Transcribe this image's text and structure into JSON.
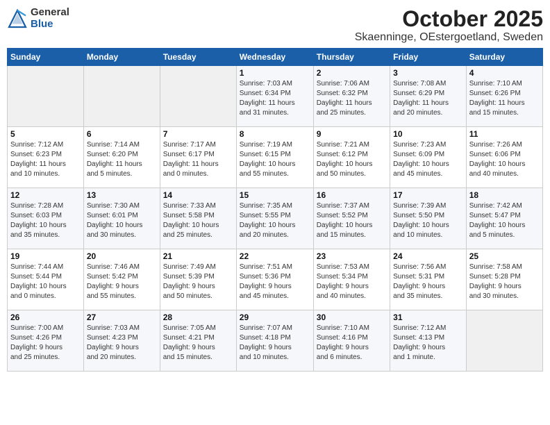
{
  "header": {
    "logo_general": "General",
    "logo_blue": "Blue",
    "month_title": "October 2025",
    "location": "Skaenninge, OEstergoetland, Sweden"
  },
  "days_of_week": [
    "Sunday",
    "Monday",
    "Tuesday",
    "Wednesday",
    "Thursday",
    "Friday",
    "Saturday"
  ],
  "weeks": [
    [
      {
        "day": "",
        "info": ""
      },
      {
        "day": "",
        "info": ""
      },
      {
        "day": "",
        "info": ""
      },
      {
        "day": "1",
        "info": "Sunrise: 7:03 AM\nSunset: 6:34 PM\nDaylight: 11 hours\nand 31 minutes."
      },
      {
        "day": "2",
        "info": "Sunrise: 7:06 AM\nSunset: 6:32 PM\nDaylight: 11 hours\nand 25 minutes."
      },
      {
        "day": "3",
        "info": "Sunrise: 7:08 AM\nSunset: 6:29 PM\nDaylight: 11 hours\nand 20 minutes."
      },
      {
        "day": "4",
        "info": "Sunrise: 7:10 AM\nSunset: 6:26 PM\nDaylight: 11 hours\nand 15 minutes."
      }
    ],
    [
      {
        "day": "5",
        "info": "Sunrise: 7:12 AM\nSunset: 6:23 PM\nDaylight: 11 hours\nand 10 minutes."
      },
      {
        "day": "6",
        "info": "Sunrise: 7:14 AM\nSunset: 6:20 PM\nDaylight: 11 hours\nand 5 minutes."
      },
      {
        "day": "7",
        "info": "Sunrise: 7:17 AM\nSunset: 6:17 PM\nDaylight: 11 hours\nand 0 minutes."
      },
      {
        "day": "8",
        "info": "Sunrise: 7:19 AM\nSunset: 6:15 PM\nDaylight: 10 hours\nand 55 minutes."
      },
      {
        "day": "9",
        "info": "Sunrise: 7:21 AM\nSunset: 6:12 PM\nDaylight: 10 hours\nand 50 minutes."
      },
      {
        "day": "10",
        "info": "Sunrise: 7:23 AM\nSunset: 6:09 PM\nDaylight: 10 hours\nand 45 minutes."
      },
      {
        "day": "11",
        "info": "Sunrise: 7:26 AM\nSunset: 6:06 PM\nDaylight: 10 hours\nand 40 minutes."
      }
    ],
    [
      {
        "day": "12",
        "info": "Sunrise: 7:28 AM\nSunset: 6:03 PM\nDaylight: 10 hours\nand 35 minutes."
      },
      {
        "day": "13",
        "info": "Sunrise: 7:30 AM\nSunset: 6:01 PM\nDaylight: 10 hours\nand 30 minutes."
      },
      {
        "day": "14",
        "info": "Sunrise: 7:33 AM\nSunset: 5:58 PM\nDaylight: 10 hours\nand 25 minutes."
      },
      {
        "day": "15",
        "info": "Sunrise: 7:35 AM\nSunset: 5:55 PM\nDaylight: 10 hours\nand 20 minutes."
      },
      {
        "day": "16",
        "info": "Sunrise: 7:37 AM\nSunset: 5:52 PM\nDaylight: 10 hours\nand 15 minutes."
      },
      {
        "day": "17",
        "info": "Sunrise: 7:39 AM\nSunset: 5:50 PM\nDaylight: 10 hours\nand 10 minutes."
      },
      {
        "day": "18",
        "info": "Sunrise: 7:42 AM\nSunset: 5:47 PM\nDaylight: 10 hours\nand 5 minutes."
      }
    ],
    [
      {
        "day": "19",
        "info": "Sunrise: 7:44 AM\nSunset: 5:44 PM\nDaylight: 10 hours\nand 0 minutes."
      },
      {
        "day": "20",
        "info": "Sunrise: 7:46 AM\nSunset: 5:42 PM\nDaylight: 9 hours\nand 55 minutes."
      },
      {
        "day": "21",
        "info": "Sunrise: 7:49 AM\nSunset: 5:39 PM\nDaylight: 9 hours\nand 50 minutes."
      },
      {
        "day": "22",
        "info": "Sunrise: 7:51 AM\nSunset: 5:36 PM\nDaylight: 9 hours\nand 45 minutes."
      },
      {
        "day": "23",
        "info": "Sunrise: 7:53 AM\nSunset: 5:34 PM\nDaylight: 9 hours\nand 40 minutes."
      },
      {
        "day": "24",
        "info": "Sunrise: 7:56 AM\nSunset: 5:31 PM\nDaylight: 9 hours\nand 35 minutes."
      },
      {
        "day": "25",
        "info": "Sunrise: 7:58 AM\nSunset: 5:28 PM\nDaylight: 9 hours\nand 30 minutes."
      }
    ],
    [
      {
        "day": "26",
        "info": "Sunrise: 7:00 AM\nSunset: 4:26 PM\nDaylight: 9 hours\nand 25 minutes."
      },
      {
        "day": "27",
        "info": "Sunrise: 7:03 AM\nSunset: 4:23 PM\nDaylight: 9 hours\nand 20 minutes."
      },
      {
        "day": "28",
        "info": "Sunrise: 7:05 AM\nSunset: 4:21 PM\nDaylight: 9 hours\nand 15 minutes."
      },
      {
        "day": "29",
        "info": "Sunrise: 7:07 AM\nSunset: 4:18 PM\nDaylight: 9 hours\nand 10 minutes."
      },
      {
        "day": "30",
        "info": "Sunrise: 7:10 AM\nSunset: 4:16 PM\nDaylight: 9 hours\nand 6 minutes."
      },
      {
        "day": "31",
        "info": "Sunrise: 7:12 AM\nSunset: 4:13 PM\nDaylight: 9 hours\nand 1 minute."
      },
      {
        "day": "",
        "info": ""
      }
    ]
  ]
}
